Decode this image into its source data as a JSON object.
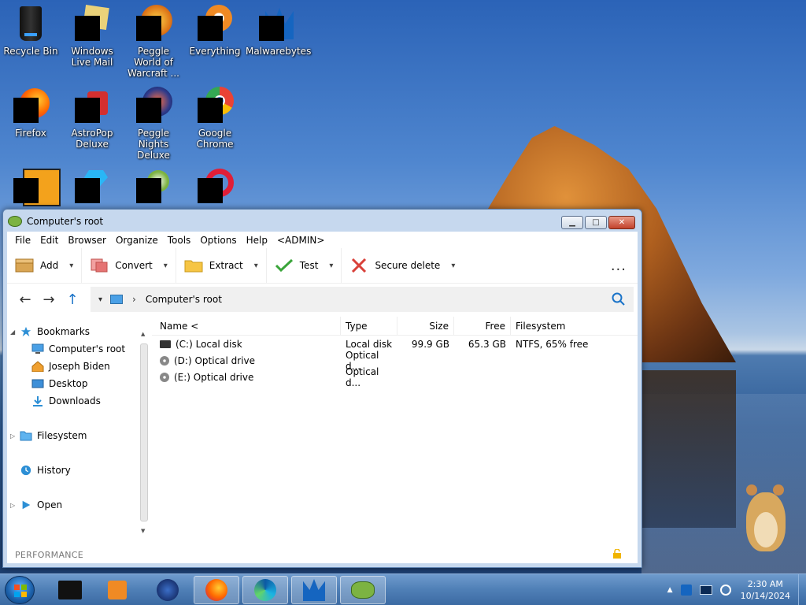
{
  "desktop": {
    "icons": [
      {
        "label": "Recycle Bin",
        "icon": "recycle-bin-icon"
      },
      {
        "label": "Windows Live Mail",
        "icon": "windows-live-mail-icon"
      },
      {
        "label": "Peggle World of Warcraft ...",
        "icon": "peggle-wow-icon"
      },
      {
        "label": "Everything",
        "icon": "everything-icon"
      },
      {
        "label": "Malwarebytes",
        "icon": "malwarebytes-icon"
      },
      {
        "label": "Firefox",
        "icon": "firefox-icon"
      },
      {
        "label": "AstroPop Deluxe",
        "icon": "astropop-icon"
      },
      {
        "label": "Peggle Nights Deluxe",
        "icon": "peggle-nights-icon"
      },
      {
        "label": "Google Chrome",
        "icon": "chrome-icon"
      },
      {
        "label": "",
        "icon": "app-icon-e"
      },
      {
        "label": "",
        "icon": "gem-icon"
      },
      {
        "label": "",
        "icon": "plant-icon"
      },
      {
        "label": "",
        "icon": "opera-icon"
      }
    ]
  },
  "window": {
    "title": "Computer's root",
    "controls": {
      "minimize": "▁",
      "maximize": "□",
      "close": "✕"
    },
    "menu": [
      "File",
      "Edit",
      "Browser",
      "Organize",
      "Tools",
      "Options",
      "Help",
      "<ADMIN>"
    ],
    "toolbar": {
      "add": "Add",
      "convert": "Convert",
      "extract": "Extract",
      "test": "Test",
      "secure_delete": "Secure delete",
      "more": "..."
    },
    "nav": {
      "back": "←",
      "forward": "→",
      "up": "↑",
      "path": "Computer's root"
    },
    "sidebar": {
      "bookmarks": "Bookmarks",
      "computers_root": "Computer's root",
      "joseph_biden": "Joseph Biden",
      "desktop": "Desktop",
      "downloads": "Downloads",
      "filesystem": "Filesystem",
      "history": "History",
      "open": "Open"
    },
    "columns": {
      "name": "Name <",
      "type": "Type",
      "size": "Size",
      "free": "Free",
      "filesystem": "Filesystem"
    },
    "rows": [
      {
        "name": "(C:) Local disk",
        "type": "Local disk",
        "size": "99.9 GB",
        "free": "65.3 GB",
        "filesystem": "NTFS, 65% free",
        "kind": "disk"
      },
      {
        "name": "(D:) Optical drive",
        "type": "Optical d...",
        "size": "",
        "free": "",
        "filesystem": "",
        "kind": "optical"
      },
      {
        "name": "(E:) Optical drive",
        "type": "Optical d...",
        "size": "",
        "free": "",
        "filesystem": "",
        "kind": "optical"
      }
    ],
    "status": "PERFORMANCE"
  },
  "taskbar": {
    "time": "2:30 AM",
    "date": "10/14/2024",
    "tray_arrow": "▲"
  }
}
